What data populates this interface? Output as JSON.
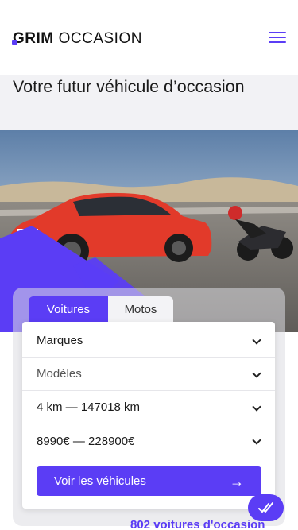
{
  "header": {
    "logo_brand": "GRIM",
    "logo_sub": "OCCASION",
    "menu_icon": "hamburger-menu-icon"
  },
  "hero": {
    "title": "Votre futur véhicule d’occasion"
  },
  "search": {
    "tabs": [
      {
        "label": "Voitures",
        "active": true
      },
      {
        "label": "Motos",
        "active": false
      }
    ],
    "fields": [
      {
        "label": "Marques"
      },
      {
        "label": "Modèles"
      },
      {
        "label": "4 km — 147018 km"
      },
      {
        "label": "8990€ — 228900€"
      }
    ],
    "submit_label": "Voir les véhicules",
    "submit_icon": "arrow-right-icon"
  },
  "results": {
    "count_text": "802 voitures d'occasion"
  },
  "colors": {
    "accent": "#5b3df5",
    "background": "#ffffff"
  },
  "fab": {
    "icon": "double-check-icon"
  }
}
